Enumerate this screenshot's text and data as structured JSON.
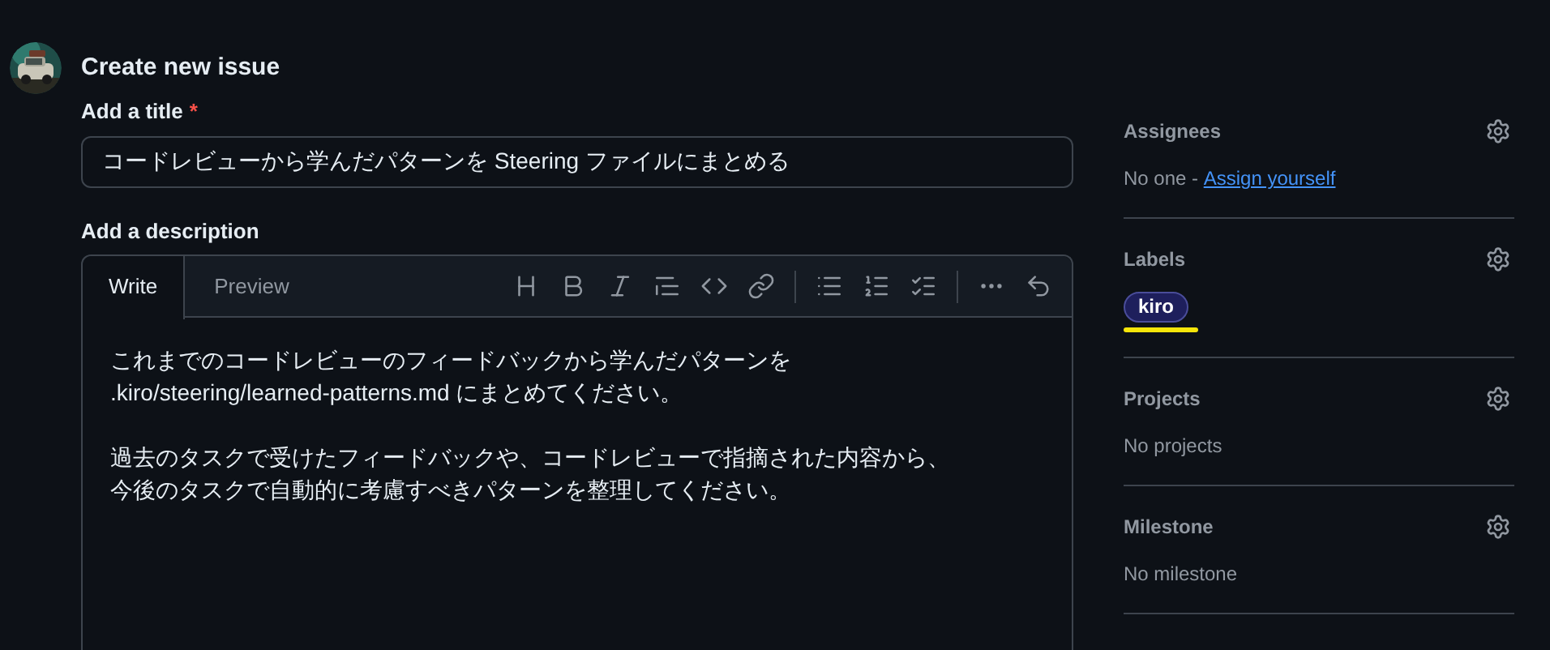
{
  "page_title": "Create new issue",
  "title_field": {
    "label": "Add a title",
    "required_mark": "*",
    "value": "コードレビューから学んだパターンを Steering ファイルにまとめる"
  },
  "description": {
    "label": "Add a description",
    "tabs": [
      {
        "label": "Write",
        "selected": true
      },
      {
        "label": "Preview",
        "selected": false
      }
    ],
    "paragraphs": [
      [
        "これまでのコードレビューのフィードバックから学んだパターンを",
        ".kiro/steering/learned-patterns.md にまとめてください。"
      ],
      [
        "過去のタスクで受けたフィードバックや、コードレビューで指摘された内容から、",
        "今後のタスクで自動的に考慮すべきパターンを整理してください。"
      ]
    ]
  },
  "sidebar": [
    {
      "kind": "assignees",
      "title": "Assignees",
      "text": "No one - ",
      "link": "Assign yourself"
    },
    {
      "kind": "labels",
      "title": "Labels",
      "labels": [
        {
          "name": "kiro",
          "color": "#1e1f5c",
          "underlined": true
        }
      ]
    },
    {
      "kind": "text",
      "title": "Projects",
      "text": "No projects"
    },
    {
      "kind": "text",
      "title": "Milestone",
      "text": "No milestone"
    }
  ]
}
